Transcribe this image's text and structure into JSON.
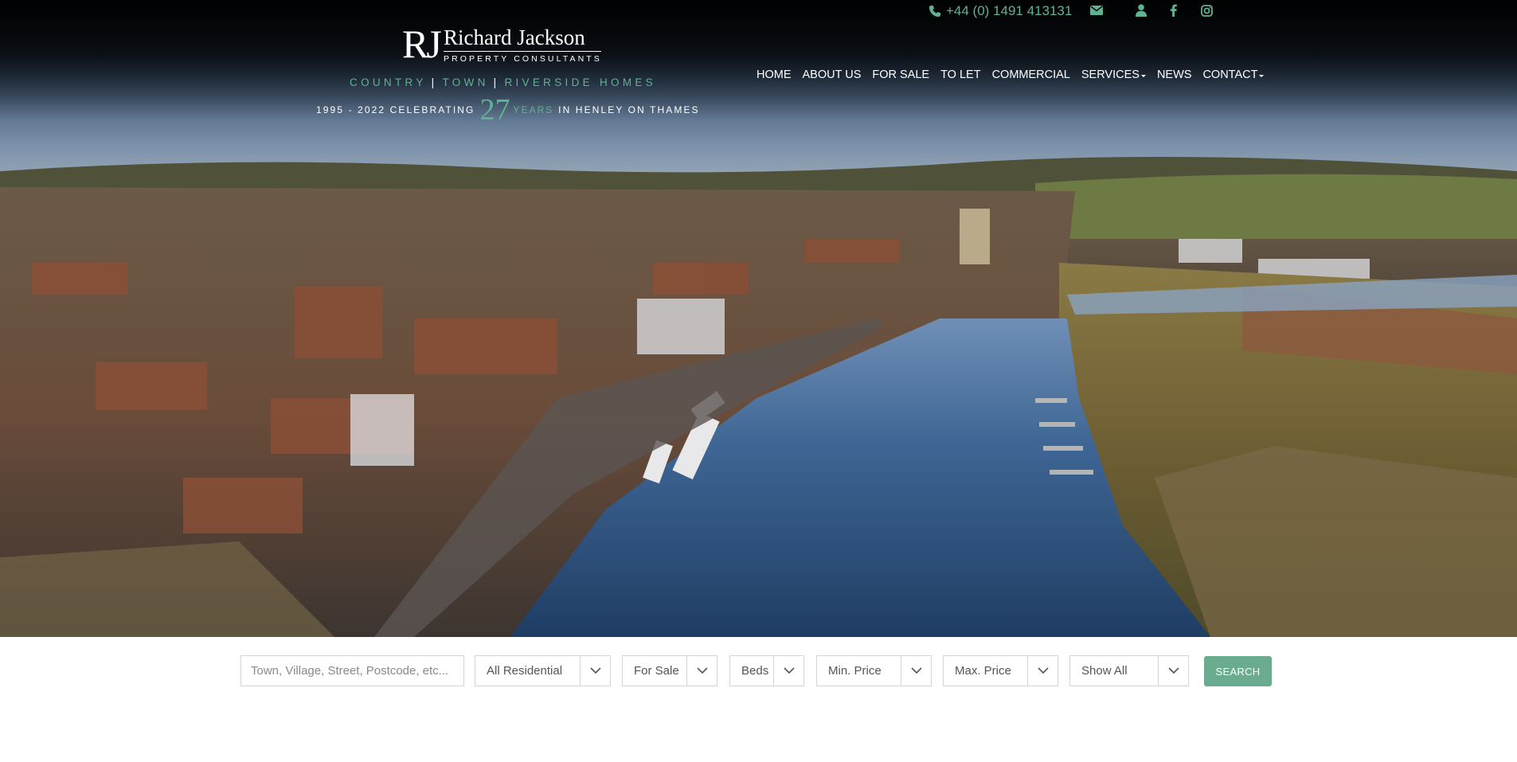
{
  "topbar": {
    "phone": "+44 (0) 1491 413131",
    "icons": [
      "phone-icon",
      "email-icon",
      "user-icon",
      "facebook-icon",
      "instagram-icon"
    ]
  },
  "logo": {
    "initials": "RJ",
    "name": "Richard Jackson",
    "subtitle": "PROPERTY CONSULTANTS"
  },
  "tagline": {
    "country": "COUNTRY",
    "sep": "|",
    "town": "TOWN",
    "riverside": "RIVERSIDE HOMES"
  },
  "celebrate": {
    "prefix": "1995 - 2022 CELEBRATING",
    "number": "27",
    "years": "YEARS",
    "suffix": "IN HENLEY ON THAMES"
  },
  "nav": {
    "home": "HOME",
    "about": "ABOUT US",
    "for_sale": "FOR SALE",
    "to_let": "TO LET",
    "commercial": "COMMERCIAL",
    "services": "SERVICES",
    "news": "NEWS",
    "contact": "CONTACT"
  },
  "search": {
    "location_placeholder": "Town, Village, Street, Postcode, etc...",
    "property_type": "All Residential",
    "listing_type": "For Sale",
    "beds": "Beds",
    "min_price": "Min. Price",
    "max_price": "Max. Price",
    "status": "Show All",
    "button": "SEARCH"
  },
  "colors": {
    "accent_green": "#5fb391",
    "button_green": "#6bac91",
    "header_bg": "#000000"
  }
}
